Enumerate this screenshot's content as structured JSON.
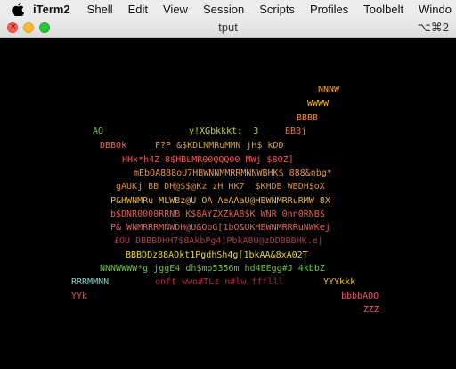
{
  "menubar": {
    "app_name": "iTerm2",
    "items": [
      "Shell",
      "Edit",
      "View",
      "Session",
      "Scripts",
      "Profiles",
      "Toolbelt",
      "Windo"
    ]
  },
  "window": {
    "title": "tput",
    "shortcut": "⌥⌘2"
  },
  "terminal": {
    "lines": [
      {
        "text": "NNNW",
        "color": "#f2a33a"
      },
      {
        "text": "WWWW",
        "color": "#f4b73c"
      },
      {
        "text": "BBBB",
        "color": "#ef8a3e"
      },
      {
        "text": "BBBj",
        "color": "#e8754a"
      },
      {
        "text": "AO",
        "color": "#8bc34a"
      },
      {
        "text": "y!XGbkkkt:  3",
        "color": "#c3d63b"
      },
      {
        "text": "DBBOk",
        "color": "#ef6a4f"
      },
      {
        "text": "F?P &$KDLNMRuMMN jH$ kDD",
        "color": "#e0a02f"
      },
      {
        "text": "HHx*h4Z 8$HBLMR00QQQ00 MWj $8OZ]",
        "color": "#f0555c"
      },
      {
        "text": "mEbOA888oU7HBWNNMMRRMNNWBHK$ 888&nbg*",
        "color": "#f0923a"
      },
      {
        "text": "gAUKj BB DH@$$@Kz zH HK7  $KHDB WBDH$oX",
        "color": "#e58b2a"
      },
      {
        "text": "P&HWNMRu MLWBz@U OA AeAAaU@HBWNMRRuRMW 8X",
        "color": "#f0b53b"
      },
      {
        "text": "b$DNR0000RRNB K$8AYZXZkA8$K WNR 0nn0RNB$",
        "color": "#ef5a4b"
      },
      {
        "text": "P& WNMRRRMNWDH@U&ObG[1bO&UKHBWNMRRRuNWKej",
        "color": "#e85d57"
      },
      {
        "text": "£OU DBBBDHH7$8AkbPg4]PbkA8U@zDDBBBHK.e|",
        "color": "#b23a4a"
      },
      {
        "text": "BBBDDz88AOkt1PgdhSh4g[1bkAA&8xA02T",
        "color": "#e8d63a"
      },
      {
        "text": "NNNWWWW*g jggE4 dh$mp5356m hd4EEgg#J 4kbbZ",
        "color": "#6cc04a"
      },
      {
        "text": "RRRMMNN",
        "color": "#7fd0c8"
      },
      {
        "text": "onft wwo#TLz n#lw ffflll",
        "color": "#c2243a"
      },
      {
        "text": "YYYkkk",
        "color": "#e8c33a"
      },
      {
        "text": "YYk",
        "color": "#ef4f5a"
      },
      {
        "text": "bbbbAOO",
        "color": "#ef4f6a"
      },
      {
        "text": "ZZZ",
        "color": "#ef4f6a"
      }
    ]
  }
}
